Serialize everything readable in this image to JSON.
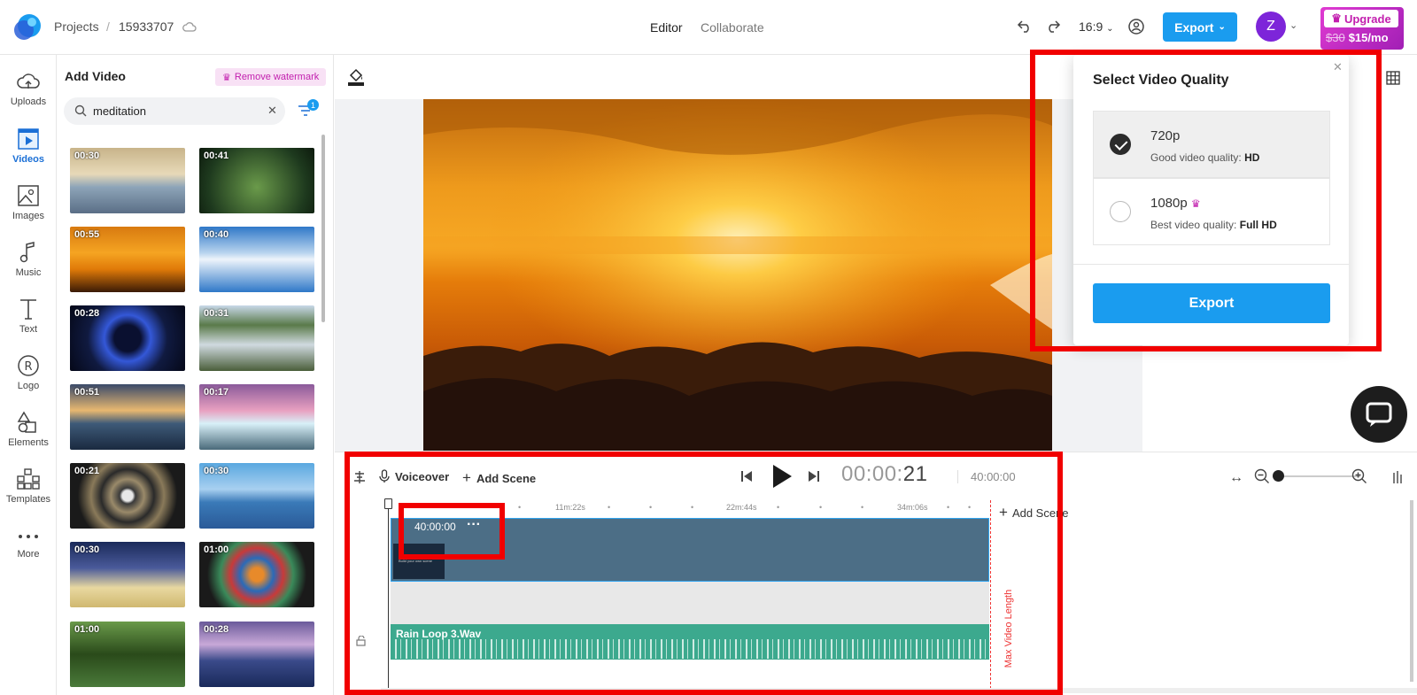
{
  "topbar": {
    "breadcrumb_projects": "Projects",
    "breadcrumb_sep": "/",
    "project_id": "15933707",
    "tab_editor": "Editor",
    "tab_collaborate": "Collaborate",
    "aspect_ratio": "16:9",
    "export_label": "Export",
    "avatar_initial": "Z",
    "upgrade_label": "Upgrade",
    "upgrade_old_price": "$30",
    "upgrade_new_price": "$15/mo"
  },
  "rail": {
    "items": [
      {
        "label": "Uploads",
        "icon": "upload-cloud-icon"
      },
      {
        "label": "Videos",
        "icon": "video-play-icon"
      },
      {
        "label": "Images",
        "icon": "image-icon"
      },
      {
        "label": "Music",
        "icon": "music-note-icon"
      },
      {
        "label": "Text",
        "icon": "text-icon"
      },
      {
        "label": "Logo",
        "icon": "registered-icon"
      },
      {
        "label": "Elements",
        "icon": "shapes-icon"
      },
      {
        "label": "Templates",
        "icon": "templates-icon"
      },
      {
        "label": "More",
        "icon": "more-icon"
      }
    ],
    "active_index": 1
  },
  "panel": {
    "title": "Add Video",
    "remove_watermark": "Remove watermark",
    "search_value": "meditation",
    "filter_badge": "1",
    "thumbnails": [
      {
        "duration": "00:30"
      },
      {
        "duration": "00:41"
      },
      {
        "duration": "00:55"
      },
      {
        "duration": "00:40"
      },
      {
        "duration": "00:28"
      },
      {
        "duration": "00:31"
      },
      {
        "duration": "00:51"
      },
      {
        "duration": "00:17"
      },
      {
        "duration": "00:21"
      },
      {
        "duration": "00:30"
      },
      {
        "duration": "00:30"
      },
      {
        "duration": "01:00"
      },
      {
        "duration": "01:00"
      },
      {
        "duration": "00:28"
      }
    ]
  },
  "popup": {
    "title": "Select Video Quality",
    "options": [
      {
        "name": "720p",
        "desc_prefix": "Good video quality: ",
        "desc_bold": "HD",
        "selected": true
      },
      {
        "name": "1080p",
        "desc_prefix": "Best video quality: ",
        "desc_bold": "Full HD",
        "selected": false,
        "premium": true
      }
    ],
    "export_label": "Export"
  },
  "timeline": {
    "voiceover_label": "Voiceover",
    "add_scene_label": "Add Scene",
    "current_time_dim": "00:00:",
    "current_time_bright": "21",
    "total_time": "40:00:00",
    "ticks": [
      "11m:22s",
      "22m:44s",
      "34m:06s"
    ],
    "scene_duration": "40:00:00",
    "scene_thumb_text": "Build your own scene",
    "audio_label": "Rain Loop 3.Wav",
    "max_length_label": "Max Video Length",
    "add_scene_right": "Add Scene"
  },
  "colors": {
    "accent": "#1a9cef",
    "highlight": "#f10000",
    "avatar": "#7d25d9",
    "upgrade": "#c21fae",
    "audio": "#3ca98e",
    "scene": "#4c6e86"
  }
}
